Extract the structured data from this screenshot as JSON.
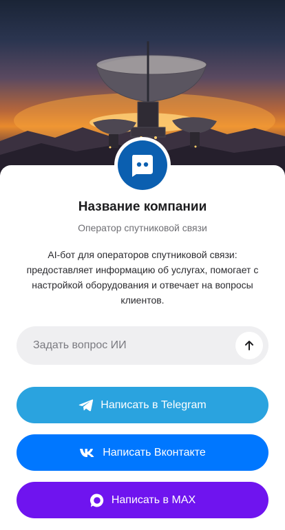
{
  "hero": {
    "image": "satellite-dishes-sunset"
  },
  "company": {
    "name": "Название компании",
    "subtitle": "Оператор спутниковой связи",
    "description": "AI-бот для операторов спутниковой связи: предоставляет информацию об услугах, помогает с настройкой оборудования и отвечает на вопросы клиентов.",
    "avatar_icon": "chat-bot-icon"
  },
  "ask": {
    "placeholder": "Задать вопрос ИИ",
    "value": "",
    "send_icon": "arrow-up-icon"
  },
  "buttons": {
    "telegram": {
      "label": "Написать в Telegram",
      "icon": "telegram-icon",
      "color": "#2aa3df"
    },
    "vk": {
      "label": "Написать Вконтакте",
      "icon": "vk-icon",
      "color": "#0077ff"
    },
    "max": {
      "label": "Написать в MAX",
      "icon": "max-icon",
      "color": "#6f14ef"
    }
  },
  "colors": {
    "accent": "#0b5fb0",
    "input_bg": "#efeff1"
  }
}
